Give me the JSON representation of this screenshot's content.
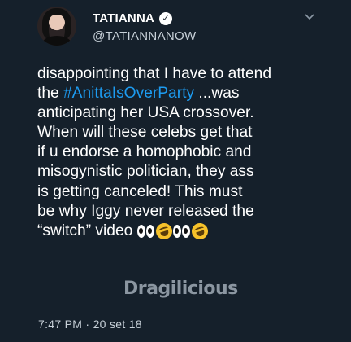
{
  "user": {
    "display_name": "TATIANNA",
    "handle": "@TATIANNANOW",
    "avatar_icon": "profile-photo",
    "verified_icon": "verified-badge-icon"
  },
  "tweet": {
    "lines": [
      "disappointing that I have to attend",
      "the ",
      "anticipating her USA crossover.",
      "When will these celebs get that",
      "if u endorse a homophobic and",
      "misogynistic politician, they ass",
      "is getting canceled! This must",
      "be why Iggy never released the",
      "“switch” video"
    ],
    "hashtag": "#AnittaIsOverParty",
    "after_hashtag": " ...was",
    "emojis": [
      "eyes",
      "rolling-on-the-floor-laughing",
      "eyes",
      "rolling-on-the-floor-laughing"
    ]
  },
  "watermark": "Dragilicious",
  "timestamp": "7:47 PM · 20 set 18",
  "colors": {
    "background": "#15202b",
    "hashtag": "#1d9bf0",
    "text": "#ffffff",
    "secondary": "#c8d1d9"
  }
}
